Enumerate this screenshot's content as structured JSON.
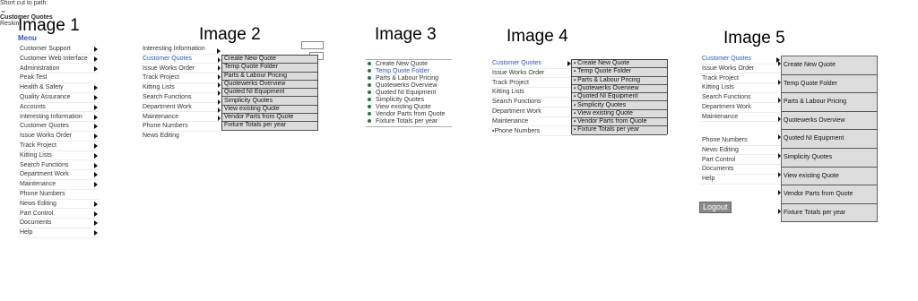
{
  "titles": [
    "Image 1",
    "Image 2",
    "Image 3",
    "Image 4",
    "Image 5"
  ],
  "panel1": {
    "menu_header": "Menu",
    "items": [
      {
        "label": "Customer Support",
        "arrow": true
      },
      {
        "label": "Customer Web Interface",
        "arrow": true
      },
      {
        "label": "Administration",
        "arrow": true
      },
      {
        "label": "Peak Test",
        "arrow": false
      },
      {
        "label": "Health & Safety",
        "arrow": true
      },
      {
        "label": "Quality Assurance",
        "arrow": true
      },
      {
        "label": "Accounts",
        "arrow": true
      },
      {
        "label": "Interesting Information",
        "arrow": true
      },
      {
        "label": "Customer Quotes",
        "arrow": true
      },
      {
        "label": "Issue Works Order",
        "arrow": true
      },
      {
        "label": "Track Project",
        "arrow": true
      },
      {
        "label": "Kitting Lists",
        "arrow": true
      },
      {
        "label": "Search Functions",
        "arrow": true
      },
      {
        "label": "Department Work",
        "arrow": true
      },
      {
        "label": "Maintenance",
        "arrow": true
      },
      {
        "label": "Phone Numbers",
        "arrow": false
      },
      {
        "label": "News Editing",
        "arrow": true
      },
      {
        "label": "Part Control",
        "arrow": true
      },
      {
        "label": "Documents",
        "arrow": true
      },
      {
        "label": "Help",
        "arrow": true
      }
    ]
  },
  "panel2": {
    "items": [
      "Interesting Information",
      "Customer Quotes",
      "Issue Works Order",
      "Track Project",
      "Kitting Lists",
      "Search Functions",
      "Department Work",
      "Maintenance",
      "Phone Numbers",
      "News Editing"
    ],
    "shortcut_label": "Short cut to path:",
    "flyout": [
      "Create New Quote",
      "Temp Quote Folder",
      "Parts & Labour Pricing",
      "Quotewerks Overview",
      "Quoted NI Equipment",
      "Simplicity Quotes",
      "View existing Quote",
      "Vendor Parts from Quote",
      "Fixture Totals per year"
    ]
  },
  "panel3": {
    "header": "Customer Quotes",
    "items": [
      "Create New Quote",
      "Temp Quote Folder",
      "Parts & Labour Pricing",
      "Quotewerks Overview",
      "Quoted NI Equipment",
      "Simplicity Quotes",
      "View existing Quote",
      "Vendor Parts from Quote",
      "Fixture Totals per year"
    ]
  },
  "panel4": {
    "items": [
      "Customer Quotes",
      "Issue Works Order",
      "Track Project",
      "Kitting Lists",
      "Search Functions",
      "Department Work",
      "Maintenance",
      "Phone Numbers"
    ],
    "flyout": [
      "Create New Quote",
      "Temp Quote Folder",
      "Parts & Labour Pricing",
      "Quotewerks Overview",
      "Quoted NI Equipment",
      "Simplicity Quotes",
      "View existing Quote",
      "Vendor Parts from Quote",
      "Fixture Totals per year"
    ]
  },
  "panel5": {
    "items_top": [
      "Customer Quotes",
      "Issue Works Order",
      "Track Project",
      "Kitting Lists",
      "Search Functions",
      "Department Work",
      "Maintenance"
    ],
    "items_bottom": [
      "Phone Numbers",
      "News Editing",
      "Part Control",
      "Documents",
      "Help"
    ],
    "reskin": "Reskin",
    "logout": "Logout",
    "flyout": [
      "Create New Quote",
      "Temp Quote Folder",
      "Parts & Labour Pricing",
      "Quotewerks Overview",
      "Quoted NI Equipment",
      "Simplicity Quotes",
      "View existing Quote",
      "Vendor Parts from Quote",
      "Fixture Totals per year"
    ]
  },
  "colors": {
    "link_blue": "#2a56c6",
    "bullet_green": "#1f7a3a",
    "flyout_bg": "#dcdcdc",
    "logout_bg": "#8a8a8a"
  }
}
